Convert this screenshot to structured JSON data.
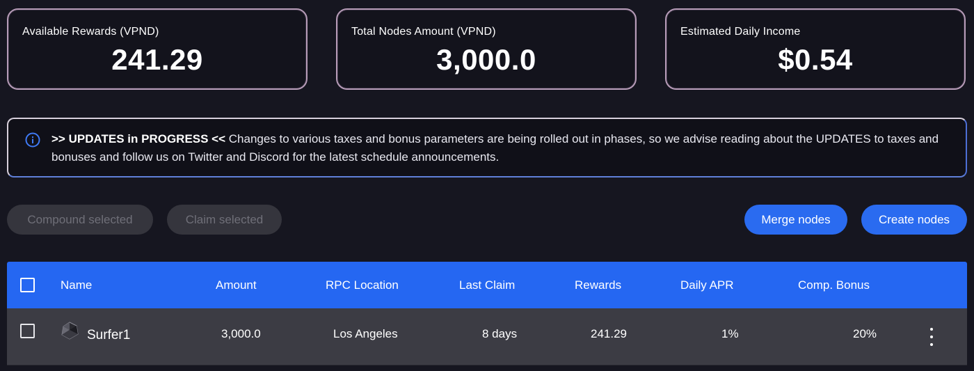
{
  "stats": [
    {
      "label": "Available Rewards (VPND)",
      "value": "241.29"
    },
    {
      "label": "Total Nodes Amount (VPND)",
      "value": "3,000.0"
    },
    {
      "label": "Estimated Daily Income",
      "value": "$0.54"
    }
  ],
  "alert": {
    "icon": "info-icon",
    "headline": ">> UPDATES in PROGRESS <<",
    "body": " Changes to various taxes and bonus parameters are being rolled out in phases, so we advise reading about the UPDATES to taxes and bonuses and follow us on Twitter and Discord for the latest schedule announcements."
  },
  "actions": {
    "compound_label": "Compound selected",
    "claim_label": "Claim selected",
    "merge_label": "Merge nodes",
    "create_label": "Create nodes"
  },
  "table": {
    "columns": [
      "Name",
      "Amount",
      "RPC Location",
      "Last Claim",
      "Rewards",
      "Daily APR",
      "Comp. Bonus"
    ],
    "rows": [
      {
        "icon": "node-crystal-icon",
        "name": "Surfer1",
        "amount": "3,000.0",
        "rpc_location": "Los Angeles",
        "last_claim": "8 days",
        "rewards": "241.29",
        "daily_apr": "1%",
        "comp_bonus": "20%"
      }
    ]
  },
  "colors": {
    "background": "#161620",
    "accent": "#2a6bf0",
    "card_border": "#b79cb8",
    "row_background": "#3c3c44"
  }
}
